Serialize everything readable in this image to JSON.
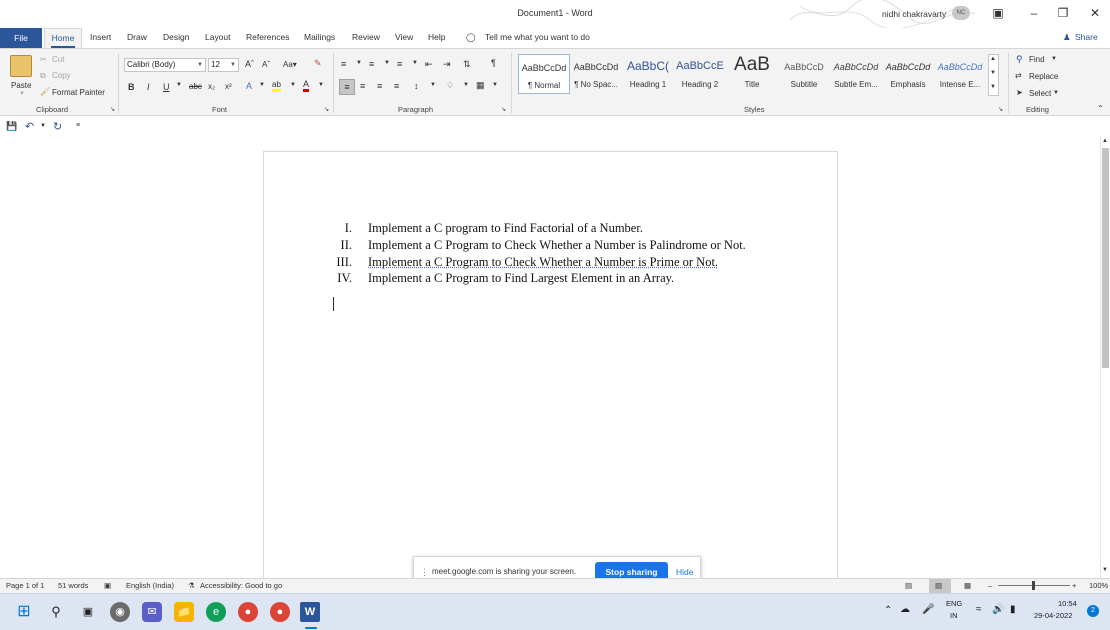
{
  "titlebar": {
    "doc_title": "Document1 - Word",
    "user_name": "nidhi chakravarty",
    "user_initials": "NC"
  },
  "tabs": [
    "File",
    "Home",
    "Insert",
    "Draw",
    "Design",
    "Layout",
    "References",
    "Mailings",
    "Review",
    "View",
    "Help"
  ],
  "tell_me": "Tell me what you want to do",
  "share_label": "Share",
  "clipboard": {
    "paste": "Paste",
    "cut": "Cut",
    "copy": "Copy",
    "format_painter": "Format Painter",
    "group_label": "Clipboard"
  },
  "font": {
    "name": "Calibri (Body)",
    "size": "12",
    "group_label": "Font"
  },
  "paragraph": {
    "group_label": "Paragraph"
  },
  "styles": {
    "group_label": "Styles",
    "items": [
      {
        "sample": "AaBbCcDd",
        "name": "¶ Normal"
      },
      {
        "sample": "AaBbCcDd",
        "name": "¶ No Spac..."
      },
      {
        "sample": "AaBbC(",
        "name": "Heading 1"
      },
      {
        "sample": "AaBbCcE",
        "name": "Heading 2"
      },
      {
        "sample": "AaB",
        "name": "Title"
      },
      {
        "sample": "AaBbCcD",
        "name": "Subtitle"
      },
      {
        "sample": "AaBbCcDd",
        "name": "Subtle Em..."
      },
      {
        "sample": "AaBbCcDd",
        "name": "Emphasis"
      },
      {
        "sample": "AaBbCcDd",
        "name": "Intense E..."
      }
    ]
  },
  "editing": {
    "find": "Find",
    "replace": "Replace",
    "select": "Select",
    "group_label": "Editing"
  },
  "document": {
    "list": [
      {
        "num": "I.",
        "text": "Implement a C program to Find Factorial of a Number."
      },
      {
        "num": "II.",
        "text": "Implement a C Program to Check Whether a Number is Palindrome or Not."
      },
      {
        "num": "III.",
        "text": "Implement  a C Program to Check Whether a Number is Prime or Not."
      },
      {
        "num": "IV.",
        "text": "Implement a C Program to Find Largest Element in an Array."
      }
    ]
  },
  "share_banner": {
    "message": "meet.google.com is sharing your screen.",
    "stop": "Stop sharing",
    "hide": "Hide"
  },
  "status": {
    "page": "Page 1 of 1",
    "words": "51 words",
    "language": "English (India)",
    "accessibility": "Accessibility: Good to go",
    "zoom": "100%"
  },
  "taskbar": {
    "lang1": "ENG",
    "lang2": "IN",
    "time": "10:54",
    "date": "29-04-2022",
    "notif_count": "2"
  },
  "colors": {
    "word_blue": "#2b579a",
    "meet_blue": "#1a73e8",
    "taskbar": "#dde5f2"
  }
}
